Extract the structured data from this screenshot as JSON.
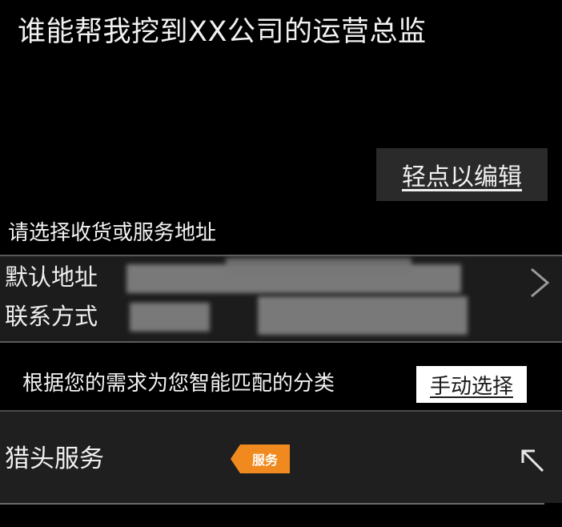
{
  "header": {
    "title": "谁能帮我挖到XX公司的运营总监"
  },
  "edit": {
    "label": "轻点以编辑"
  },
  "address": {
    "section_title": "请选择收货或服务地址",
    "default_label": "默认地址",
    "contact_label": "联系方式",
    "chevron_icon": "chevron-right-icon"
  },
  "match": {
    "text": "根据您的需求为您智能匹配的分类",
    "manual_label": "手动选择"
  },
  "service": {
    "label": "猎头服务",
    "tag": "服务",
    "tag_color": "#f08a1e",
    "action_icon": "arrow-up-left-icon"
  }
}
